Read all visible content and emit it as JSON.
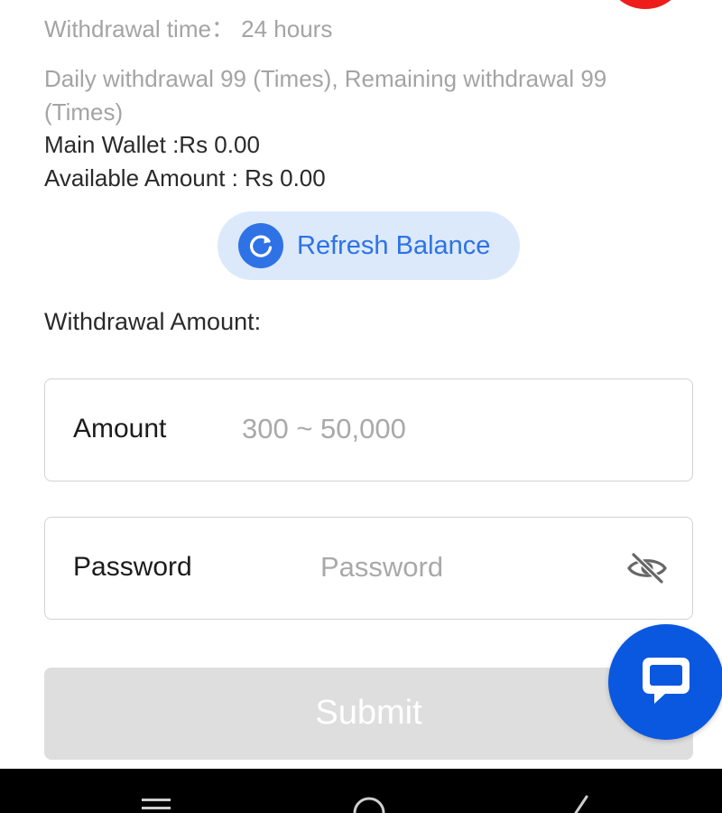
{
  "info": {
    "withdrawal_time": "Withdrawal time：  24 hours",
    "limits_line1": "Daily withdrawal 99 (Times), Remaining withdrawal 99",
    "limits_line2": "(Times)",
    "main_wallet": "Main Wallet :Rs 0.00",
    "available_amount": "Available Amount : Rs 0.00"
  },
  "refresh": {
    "label": "Refresh Balance"
  },
  "withdrawal_amount_label": "Withdrawal Amount:",
  "amount_field": {
    "label": "Amount",
    "placeholder": "300 ~ 50,000",
    "value": ""
  },
  "password_field": {
    "label": "Password",
    "placeholder": "Password",
    "value": ""
  },
  "submit": {
    "label": "Submit"
  },
  "icons": {
    "refresh": "refresh-icon",
    "eye": "eye-off-icon",
    "chat": "chat-icon",
    "nav_menu": "menu-icon",
    "nav_home": "home-icon",
    "nav_back": "back-icon"
  },
  "colors": {
    "accent": "#2e72e6",
    "accent_bg": "#dbe9fb",
    "chat_fab": "#0a58e0",
    "notification": "#ef1c1c",
    "submit_disabled": "#dedede"
  }
}
